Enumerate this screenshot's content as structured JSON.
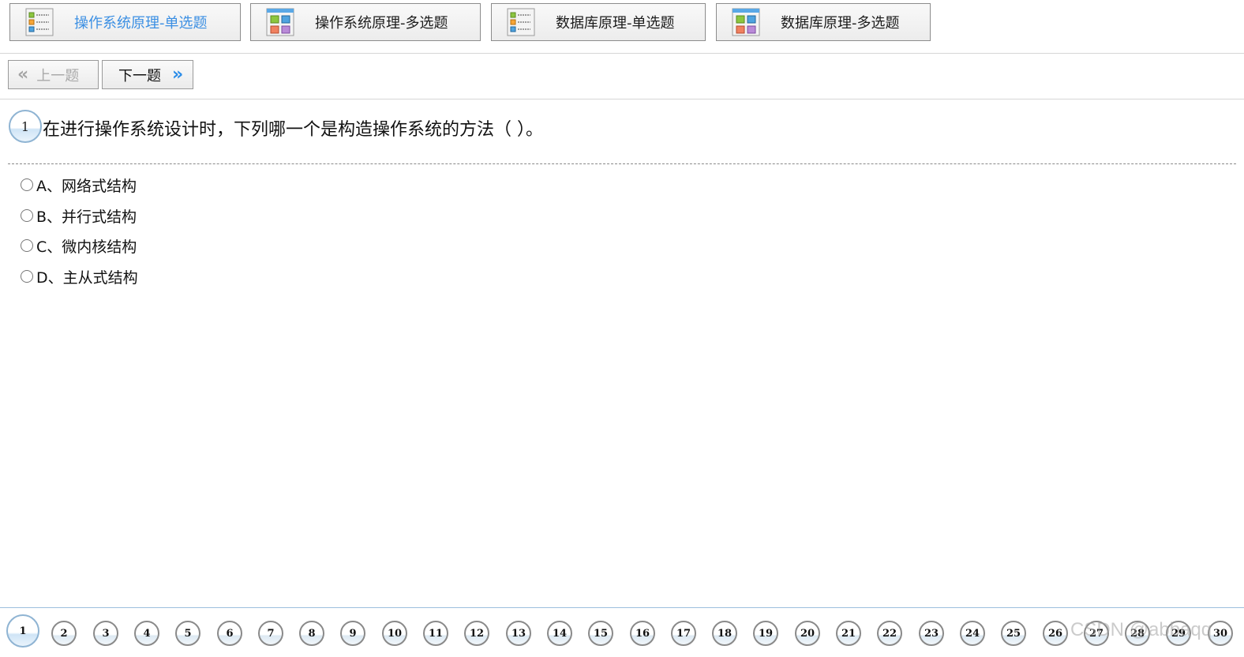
{
  "tabs": [
    {
      "label": "操作系统原理-单选题",
      "icon": "list-icon",
      "active": true
    },
    {
      "label": "操作系统原理-多选题",
      "icon": "grid-icon",
      "active": false
    },
    {
      "label": "数据库原理-单选题",
      "icon": "list-icon",
      "active": false
    },
    {
      "label": "数据库原理-多选题",
      "icon": "grid-icon",
      "active": false
    }
  ],
  "nav": {
    "prev_label": "上一题",
    "next_label": "下一题",
    "prev_enabled": false
  },
  "question": {
    "number": "1",
    "text": "在进行操作系统设计时，下列哪一个是构造操作系统的方法（ ）。"
  },
  "options": [
    {
      "label": "A、网络式结构"
    },
    {
      "label": "B、并行式结构"
    },
    {
      "label": "C、微内核结构"
    },
    {
      "label": "D、主从式结构"
    }
  ],
  "pager": {
    "current": "1",
    "pages": [
      "1",
      "2",
      "3",
      "4",
      "5",
      "6",
      "7",
      "8",
      "9",
      "10",
      "11",
      "12",
      "13",
      "14",
      "15",
      "16",
      "17",
      "18",
      "19",
      "20",
      "21",
      "22",
      "23",
      "24",
      "25",
      "26",
      "27",
      "28",
      "29",
      "30"
    ]
  },
  "watermark": "CSDN @abbaqq",
  "colors": {
    "accent": "#3b8fe3",
    "chevron": "#2a8ce8",
    "circle_border": "#8fb4d3"
  }
}
